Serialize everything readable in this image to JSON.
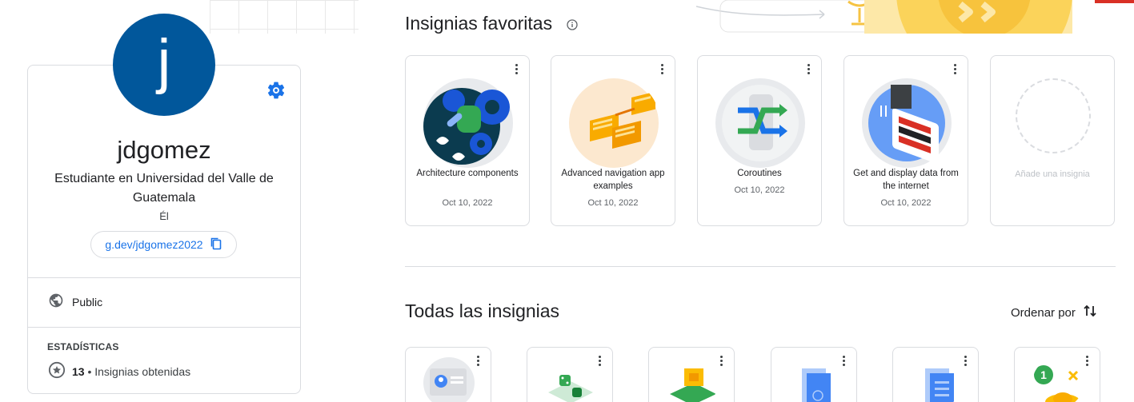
{
  "profile": {
    "avatar_letter": "j",
    "avatar_color": "#01579b",
    "username": "jdgomez",
    "headline": "Estudiante en Universidad del Valle de Guatemala",
    "pronoun": "Él",
    "profile_link": "g.dev/jdgomez2022",
    "visibility": "Public",
    "stats_title": "ESTADÍSTICAS",
    "badges_count": "13",
    "badges_label": "• Insignias obtenidas"
  },
  "favorites": {
    "title": "Insignias favoritas",
    "badges": [
      {
        "name": "Architecture components",
        "date": "Oct 10, 2022"
      },
      {
        "name": "Advanced navigation app examples",
        "date": "Oct 10, 2022"
      },
      {
        "name": "Coroutines",
        "date": "Oct 10, 2022"
      },
      {
        "name": "Get and display data from the internet",
        "date": "Oct 10, 2022"
      }
    ],
    "add_label": "Añade una insignia"
  },
  "all_badges": {
    "title": "Todas las insignias",
    "sort_label": "Ordenar por",
    "badge_count_visible": 6
  },
  "colors": {
    "accent": "#1a73e8",
    "border": "#dadce0",
    "text": "#202124"
  }
}
